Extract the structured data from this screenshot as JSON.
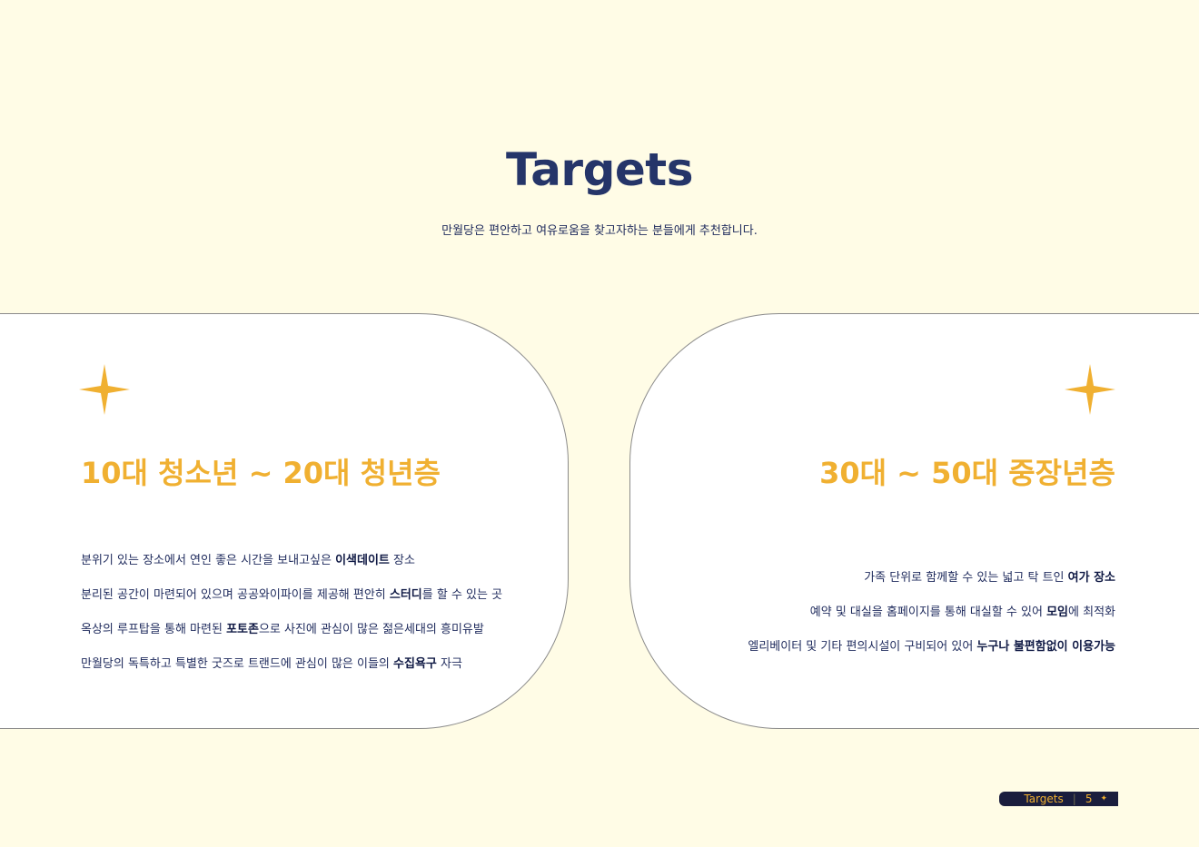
{
  "header": {
    "title": "Targets",
    "subtitle": "만월당은 편안하고 여유로움을 찾고자하는 분들에게 추천합니다."
  },
  "cards": [
    {
      "icon": "star-icon",
      "heading": "10대 청소년 ~ 20대 청년층",
      "items": [
        {
          "pre": "분위기 있는 장소에서 연인 좋은 시간을 보내고싶은 ",
          "bold": "이색데이트",
          "post": " 장소"
        },
        {
          "pre": "분리된 공간이 마련되어 있으며 공공와이파이를 제공해 편안히 ",
          "bold": "스터디",
          "post": "를 할 수 있는 곳"
        },
        {
          "pre": "옥상의 루프탑을 통해 마련된 ",
          "bold": "포토존",
          "post": "으로 사진에 관심이 많은 젊은세대의 흥미유발"
        },
        {
          "pre": "만월당의 독특하고 특별한 굿즈로 트랜드에 관심이 많은 이들의 ",
          "bold": "수집욕구",
          "post": " 자극"
        }
      ]
    },
    {
      "icon": "star-icon",
      "heading": "30대 ~ 50대 중장년층",
      "items": [
        {
          "pre": "가족 단위로 함께할 수 있는 넓고 탁 트인 ",
          "bold": "여가 장소",
          "post": ""
        },
        {
          "pre": "예약 및 대실을 홈페이지를 통해 대실할 수 있어 ",
          "bold": "모임",
          "post": "에 최적화"
        },
        {
          "pre": "엘리베이터 및 기타 편의시설이 구비되어 있어 ",
          "bold": "누구나 불편함없이 이용가능",
          "post": ""
        }
      ]
    }
  ],
  "footer": {
    "label": "Targets",
    "page": "5",
    "mark": "✦"
  },
  "colors": {
    "background": "#fffce6",
    "accent": "#f0b031",
    "navy": "#253569"
  }
}
